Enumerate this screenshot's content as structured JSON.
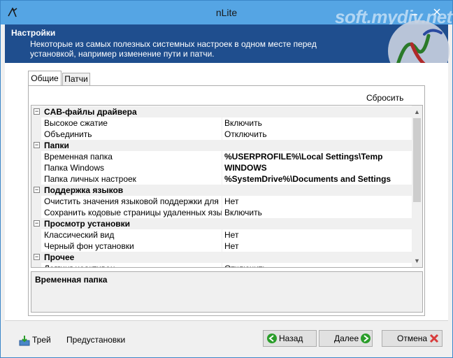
{
  "window": {
    "title": "nLite",
    "watermark": "soft.mydiv.net"
  },
  "header": {
    "title": "Настройки",
    "description": "Некоторые из самых полезных системных настроек в одном месте перед установкой, например изменение пути и патчи."
  },
  "tabs": [
    {
      "label": "Общие",
      "active": true
    },
    {
      "label": "Патчи",
      "active": false
    }
  ],
  "reset_label": "Сбросить",
  "grid": {
    "categories": [
      {
        "name": "CAB-файлы драйвера",
        "items": [
          {
            "name": "Высокое сжатие",
            "value": "Включить",
            "bold": false
          },
          {
            "name": "Объединить",
            "value": "Отключить",
            "bold": false
          }
        ]
      },
      {
        "name": "Папки",
        "items": [
          {
            "name": "Временная папка",
            "value": "%USERPROFILE%\\Local Settings\\Temp",
            "bold": true
          },
          {
            "name": "Папка Windows",
            "value": "WINDOWS",
            "bold": true
          },
          {
            "name": "Папка личных настроек",
            "value": "%SystemDrive%\\Documents and Settings",
            "bold": true
          }
        ]
      },
      {
        "name": "Поддержка языков",
        "items": [
          {
            "name": "Очистить значения языковой поддержки для MUI",
            "value": "Нет",
            "bold": false
          },
          {
            "name": "Сохранить кодовые страницы удаленных языков",
            "value": "Включить",
            "bold": false
          }
        ]
      },
      {
        "name": "Просмотр установки",
        "items": [
          {
            "name": "Классический вид",
            "value": "Нет",
            "bold": false
          },
          {
            "name": "Черный фон установки",
            "value": "Нет",
            "bold": false
          }
        ]
      },
      {
        "name": "Прочее",
        "items": [
          {
            "name": "Логгинг неактивен",
            "value": "Отключить",
            "bold": false
          }
        ]
      }
    ]
  },
  "description_box": {
    "title": "Временная папка"
  },
  "footer": {
    "tray_label": "Трей",
    "presets_label": "Предустановки",
    "back_label": "Назад",
    "next_label": "Далее",
    "cancel_label": "Отмена"
  },
  "colors": {
    "titlebar": "#55a5e4",
    "header_bg": "#1f4e8e",
    "next_arrow": "#2a9d2a",
    "cancel_x": "#d83b3b"
  }
}
